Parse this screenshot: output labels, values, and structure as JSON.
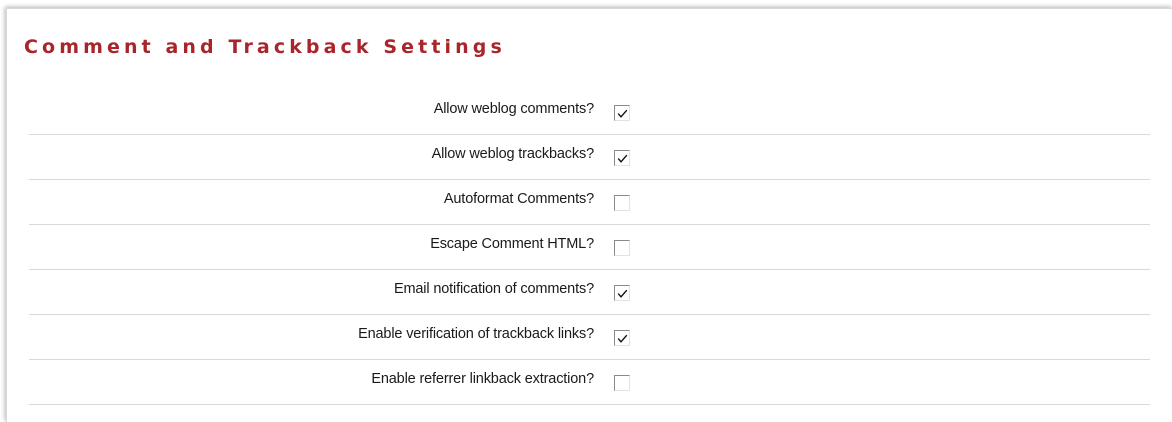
{
  "section": {
    "title": "Comment and Trackback Settings"
  },
  "settings": [
    {
      "label": "Allow weblog comments?",
      "checked": true
    },
    {
      "label": "Allow weblog trackbacks?",
      "checked": true
    },
    {
      "label": "Autoformat Comments?",
      "checked": false
    },
    {
      "label": "Escape Comment HTML?",
      "checked": false
    },
    {
      "label": "Email notification of comments?",
      "checked": true
    },
    {
      "label": "Enable verification of trackback links?",
      "checked": true
    },
    {
      "label": "Enable referrer linkback extraction?",
      "checked": false
    }
  ],
  "colors": {
    "title": "#a8262b",
    "divider": "#d9d9d9"
  },
  "icons": {
    "checkmark": "check-icon"
  }
}
